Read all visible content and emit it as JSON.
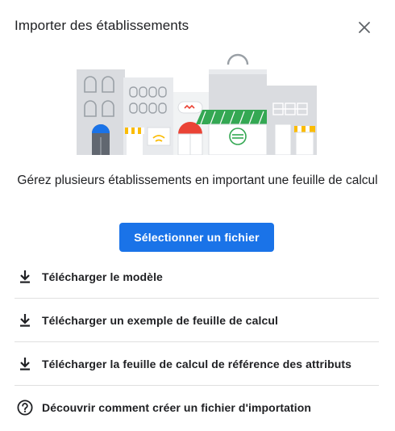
{
  "dialog": {
    "title": "Importer des établissements",
    "close_icon": "close-icon",
    "illustration": "storefronts-illustration",
    "description": "Gérez plusieurs établissements en important une feuille de calcul",
    "primary_button": "Sélectionner un fichier",
    "accent_color": "#1a73e8",
    "links": [
      {
        "icon": "download-icon",
        "label": "Télécharger le modèle"
      },
      {
        "icon": "download-icon",
        "label": "Télécharger un exemple de feuille de calcul"
      },
      {
        "icon": "download-icon",
        "label": "Télécharger la feuille de calcul de référence des attributs"
      },
      {
        "icon": "help-circle-icon",
        "label": "Découvrir comment créer un fichier d'importation"
      }
    ]
  }
}
